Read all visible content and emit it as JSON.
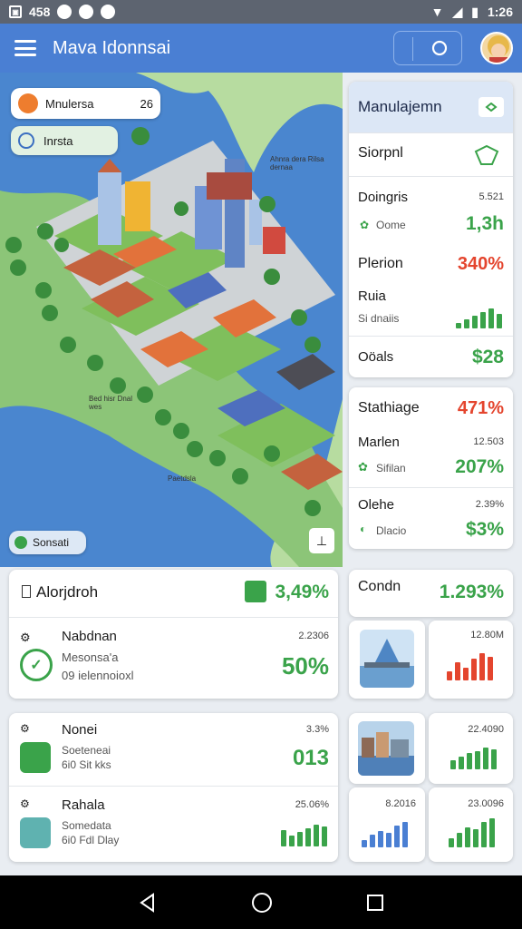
{
  "status_bar": {
    "left_text": "458",
    "time": "1:26"
  },
  "app_bar": {
    "title": "Mava Idonnsai"
  },
  "map": {
    "chip_top": {
      "label": "Mnulersa",
      "count": "26"
    },
    "chip_second": {
      "label": "Inrsta"
    },
    "chip_bottom": {
      "label": "Sonsati"
    },
    "labels": [
      "Ahnra dera Rilsa dernaa",
      "Bed hisr Dnal wes",
      "Paetdsla"
    ]
  },
  "right_panel_1": {
    "header": "Manulajemn",
    "rows": [
      {
        "label": "Siorpnl"
      },
      {
        "label": "Doingris",
        "sub": "Oome",
        "small": "5.521",
        "value": "1,3h"
      },
      {
        "label": "Plerion",
        "value": "340%"
      },
      {
        "label": "Ruia",
        "sub": "Si dnaiis"
      },
      {
        "label": "Oöals",
        "value": "$28"
      }
    ]
  },
  "right_panel_2": {
    "rows": [
      {
        "label": "Stathiage",
        "value": "471%"
      },
      {
        "label": "Marlen",
        "sub": "Sifilan",
        "small": "12.503",
        "value": "207%"
      },
      {
        "label": "Olehe",
        "sub": "Dlacio",
        "small": "2.39%",
        "value": "$3%"
      }
    ]
  },
  "panel_alorjdroh": {
    "title": "Alorjdroh",
    "value": "3,49%",
    "item": {
      "label": "Nabdnan",
      "sub1": "Mesonsa'a",
      "sub2": "09 ielennoioxl",
      "small": "2.2306",
      "value": "50%"
    }
  },
  "panel_condn": {
    "title": "Condn",
    "value": "1.293%",
    "tile_small": "12.80M"
  },
  "panel_nonei": {
    "row1": {
      "label": "Nonei",
      "sub1": "Soeteneai",
      "sub2": "6i0 Sit kks",
      "small": "3.3%",
      "value": "013"
    },
    "row2": {
      "label": "Rahala",
      "sub1": "Somedata",
      "sub2": "6i0 Fdl Dlay",
      "small": "25.06%"
    }
  },
  "tiles_bottom": [
    {
      "small": "22.4090"
    },
    {
      "small": "8.2016"
    },
    {
      "small": "23.0096"
    }
  ],
  "colors": {
    "accent": "#4a7fd3",
    "green": "#3aa34a",
    "red": "#e4452e"
  }
}
